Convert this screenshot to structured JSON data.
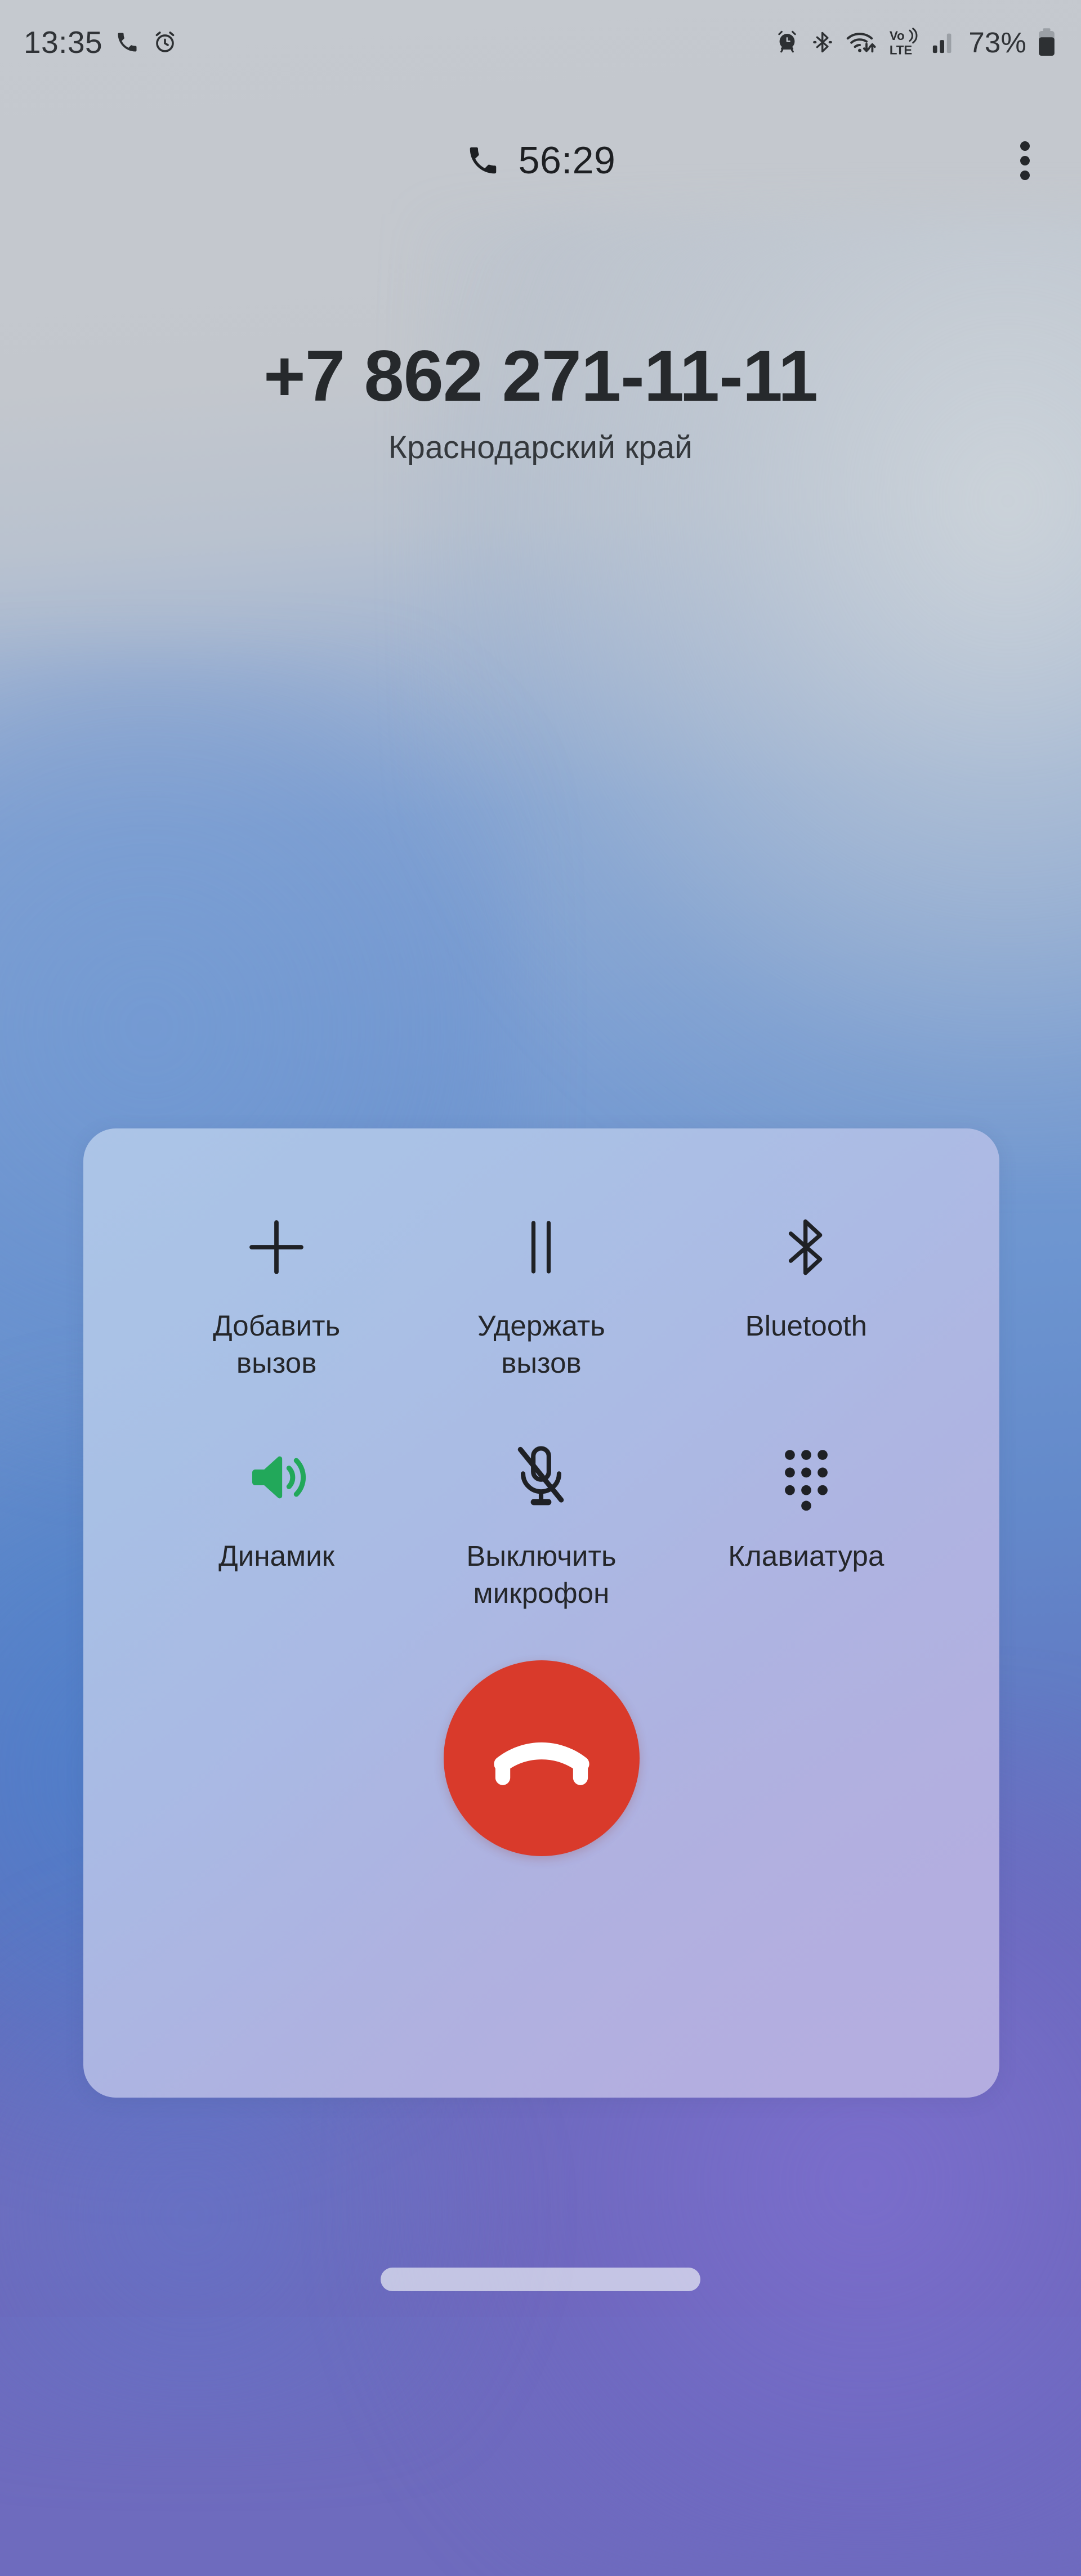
{
  "status_bar": {
    "time": "13:35",
    "battery_percent": "73%",
    "icons": [
      {
        "name": "call-active-icon",
        "label": "active call"
      },
      {
        "name": "alarm-set-icon",
        "label": "alarm"
      },
      {
        "name": "alarm-clock-icon",
        "label": "alarm clock"
      },
      {
        "name": "bluetooth-icon",
        "label": "Bluetooth"
      },
      {
        "name": "wifi-data-icon",
        "label": "Wi-Fi"
      },
      {
        "name": "volte-icon",
        "label": "VoLTE"
      },
      {
        "name": "signal-bars-icon",
        "label": "signal"
      },
      {
        "name": "battery-icon",
        "label": "battery"
      }
    ],
    "volte_top": "Vo)",
    "volte_bottom": "LTE"
  },
  "call_header": {
    "timer": "56:29",
    "phone_icon": "phone-handset-icon",
    "overflow_icon": "overflow-menu-icon"
  },
  "caller": {
    "number": "+7 862 271-11-11",
    "location": "Краснодарский край"
  },
  "controls": {
    "buttons": [
      {
        "id": "add-call",
        "icon": "plus-icon",
        "label": "Добавить вызов",
        "label_line1": "Добавить",
        "label_line2": "вызов",
        "active": false
      },
      {
        "id": "hold-call",
        "icon": "pause-icon",
        "label": "Удержать вызов",
        "label_line1": "Удержать",
        "label_line2": "вызов",
        "active": false
      },
      {
        "id": "bluetooth",
        "icon": "bluetooth-icon",
        "label": "Bluetooth",
        "label_line1": "Bluetooth",
        "label_line2": "",
        "active": false
      },
      {
        "id": "speaker",
        "icon": "speaker-icon",
        "label": "Динамик",
        "label_line1": "Динамик",
        "label_line2": "",
        "active": true
      },
      {
        "id": "mute-microphone",
        "icon": "microphone-off-icon",
        "label": "Выключить микрофон",
        "label_line1": "Выключить",
        "label_line2": "микрофон",
        "active": false
      },
      {
        "id": "keypad",
        "icon": "dialpad-icon",
        "label": "Клавиатура",
        "label_line1": "Клавиатура",
        "label_line2": "",
        "active": false
      }
    ],
    "end_call": {
      "icon": "end-call-icon",
      "aria_label": "Завершить вызов"
    }
  },
  "colors": {
    "end_call_red": "#D93A2B",
    "speaker_active_green": "#22A85A",
    "icon_dark": "#1f2125",
    "panel_light": "#B0C8E9",
    "panel_violet": "#B8B1E2",
    "status_text": "#303337"
  },
  "navigation": {
    "home_indicator": "home-indicator-pill"
  }
}
